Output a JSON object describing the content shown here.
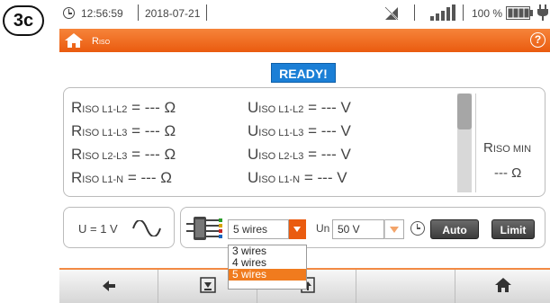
{
  "step_label": "3c",
  "status_bar": {
    "time": "12:56:59",
    "date": "2018-07-21",
    "battery_percent": "100 %",
    "icons": [
      "clock-icon",
      "no-signal-icon",
      "signal-bars-icon",
      "battery-icon",
      "plug-icon"
    ]
  },
  "title_bar": {
    "title_main": "R",
    "title_sub": "ISO",
    "icons": [
      "home-icon",
      "help-icon"
    ],
    "help_glyph": "?"
  },
  "status_badge": "READY!",
  "results": {
    "rows": [
      {
        "r_main": "R",
        "r_sub": "ISO L1-L2",
        "r_value": " = --- Ω",
        "u_main": "U",
        "u_sub": "ISO L1-L2",
        "u_value": " = --- V"
      },
      {
        "r_main": "R",
        "r_sub": "ISO L1-L3",
        "r_value": " = --- Ω",
        "u_main": "U",
        "u_sub": "ISO L1-L3",
        "u_value": " = --- V"
      },
      {
        "r_main": "R",
        "r_sub": "ISO L2-L3",
        "r_value": " = --- Ω",
        "u_main": "U",
        "u_sub": "ISO L2-L3",
        "u_value": " = --- V"
      },
      {
        "r_main": "R",
        "r_sub": "ISO L1-N",
        "r_value": " = --- Ω",
        "u_main": "U",
        "u_sub": "ISO L1-N",
        "u_value": " = --- V"
      }
    ],
    "rmin_main": "R",
    "rmin_sub": "ISO MIN",
    "rmin_value": "--- Ω"
  },
  "u_panel": {
    "label": "U = 1 V",
    "icon": "sine-wave-icon"
  },
  "settings": {
    "wires_selected": "5 wires",
    "wires_options": [
      "3 wires",
      "4 wires",
      "5 wires"
    ],
    "un_label": "Un",
    "un_value": "50 V",
    "auto_label": "Auto",
    "limit_label": "Limit",
    "icons": [
      "adapter-icon",
      "timer-icon"
    ]
  },
  "nav_bar": {
    "icons": [
      "back-arrow-icon",
      "save-icon",
      "export-icon",
      "blank",
      "blank",
      "home-icon"
    ]
  },
  "colors": {
    "accent_orange": "#ea5b0f",
    "ready_blue": "#1b7fd6"
  }
}
